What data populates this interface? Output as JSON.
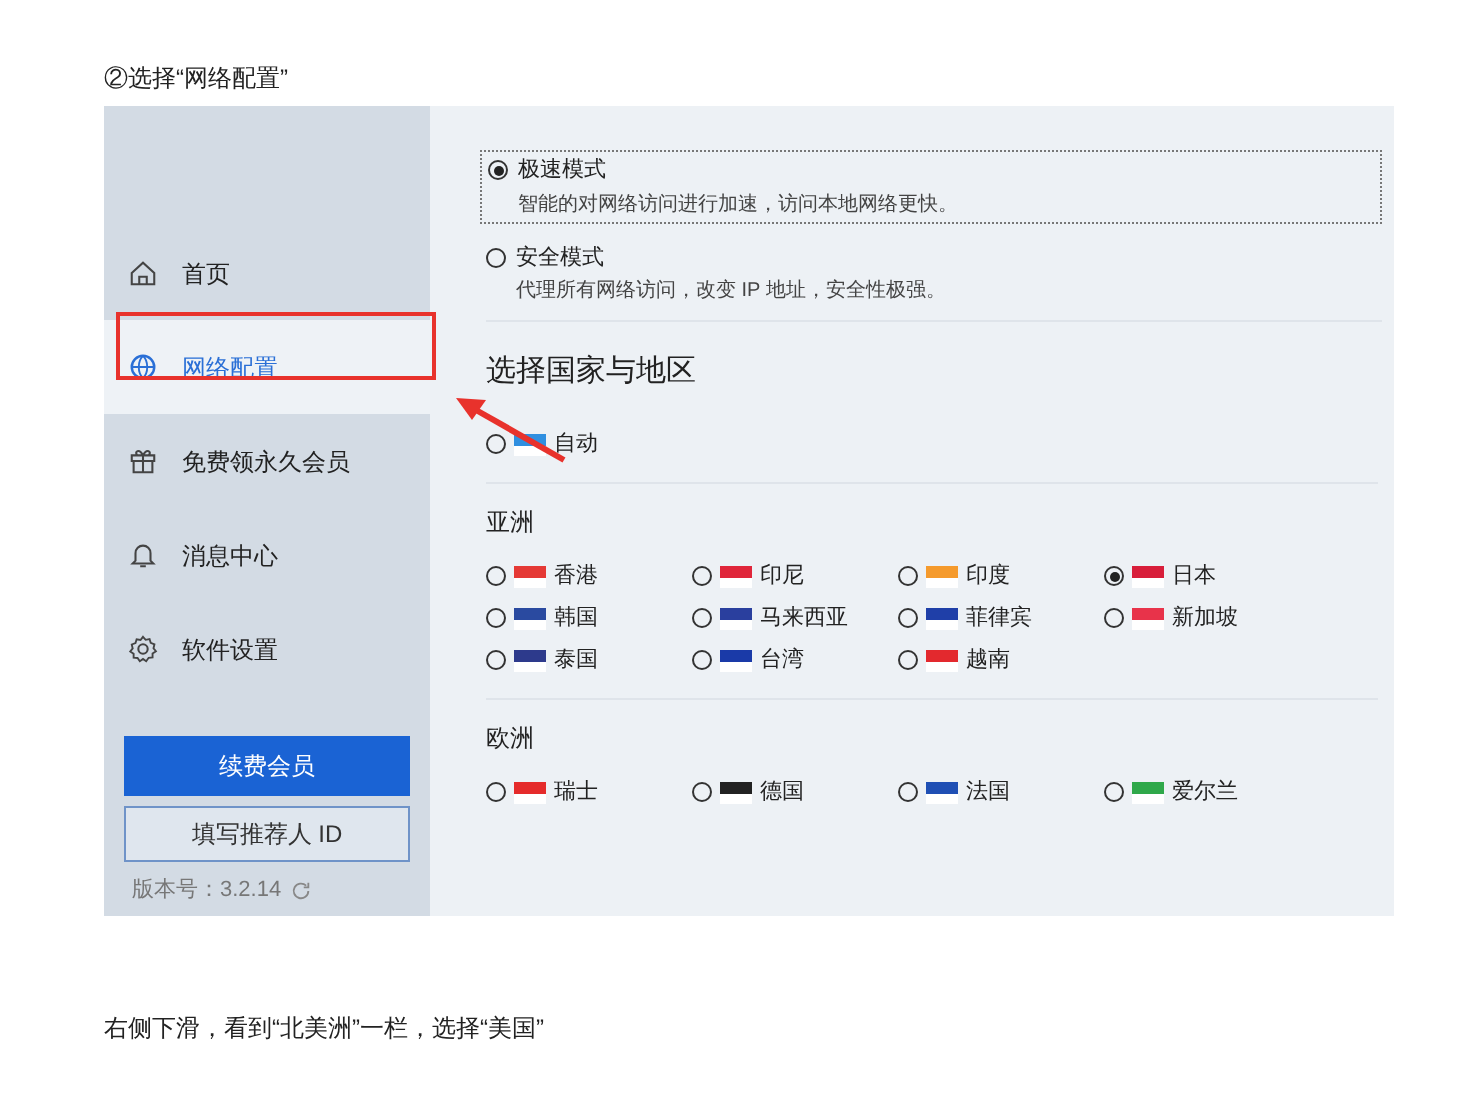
{
  "intro": "②选择“网络配置”",
  "sidebar": {
    "items": [
      {
        "label": "首页",
        "selected": false
      },
      {
        "label": "网络配置",
        "selected": true
      },
      {
        "label": "免费领永久会员",
        "selected": false
      },
      {
        "label": "消息中心",
        "selected": false
      },
      {
        "label": "软件设置",
        "selected": false
      }
    ],
    "renew_button": "续费会员",
    "referrer_button": "填写推荐人 ID",
    "version": "版本号：3.2.14"
  },
  "modes": [
    {
      "title": "极速模式",
      "description": "智能的对网络访问进行加速，访问本地网络更快。",
      "selected": true
    },
    {
      "title": "安全模式",
      "description": "代理所有网络访问，改变 IP 地址，安全性极强。",
      "selected": false
    }
  ],
  "region_heading": "选择国家与地区",
  "auto": {
    "label": "自动",
    "selected": false,
    "color": "#2f8fe0"
  },
  "groups": [
    {
      "name": "亚洲",
      "countries": [
        {
          "label": "香港",
          "selected": false,
          "color": "#e53935"
        },
        {
          "label": "印尼",
          "selected": false,
          "color": "#e0263a"
        },
        {
          "label": "印度",
          "selected": false,
          "color": "#f59a2c"
        },
        {
          "label": "日本",
          "selected": true,
          "color": "#d81e3a"
        },
        {
          "label": "韩国",
          "selected": false,
          "color": "#2a4aa0"
        },
        {
          "label": "马来西亚",
          "selected": false,
          "color": "#2a3f9e"
        },
        {
          "label": "菲律宾",
          "selected": false,
          "color": "#1f3fa8"
        },
        {
          "label": "新加坡",
          "selected": false,
          "color": "#e8334a"
        },
        {
          "label": "泰国",
          "selected": false,
          "color": "#2d3a8c"
        },
        {
          "label": "台湾",
          "selected": false,
          "color": "#1a3aa8"
        },
        {
          "label": "越南",
          "selected": false,
          "color": "#e3292e"
        }
      ]
    },
    {
      "name": "欧洲",
      "countries": [
        {
          "label": "瑞士",
          "selected": false,
          "color": "#e52b2b"
        },
        {
          "label": "德国",
          "selected": false,
          "color": "#222222"
        },
        {
          "label": "法国",
          "selected": false,
          "color": "#1f4fb4"
        },
        {
          "label": "爱尔兰",
          "selected": false,
          "color": "#2fa84a"
        }
      ]
    }
  ],
  "outro": "右侧下滑，看到“北美洲”一栏，选择“美国”"
}
